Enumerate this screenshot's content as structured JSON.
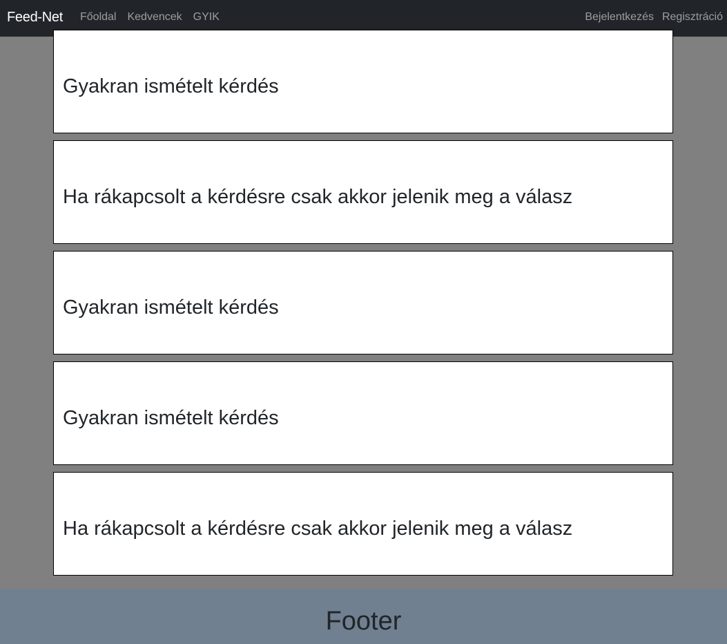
{
  "navbar": {
    "brand": "Feed-Net",
    "left_links": [
      "Főoldal",
      "Kedvencek",
      "GYIK"
    ],
    "right_links": [
      "Bejelentkezés",
      "Regisztráció"
    ]
  },
  "cards": [
    {
      "text": "Gyakran ismételt kérdés"
    },
    {
      "text": "Ha rákapcsolt a kérdésre csak akkor jelenik meg a válasz"
    },
    {
      "text": "Gyakran ismételt kérdés"
    },
    {
      "text": "Gyakran ismételt kérdés"
    },
    {
      "text": "Ha rákapcsolt a kérdésre csak akkor jelenik meg a válasz"
    }
  ],
  "footer": {
    "text": "Footer"
  },
  "colors": {
    "navbar_bg": "#212529",
    "page_bg": "#808080",
    "card_bg": "#ffffff",
    "footer_bg": "#708090"
  }
}
